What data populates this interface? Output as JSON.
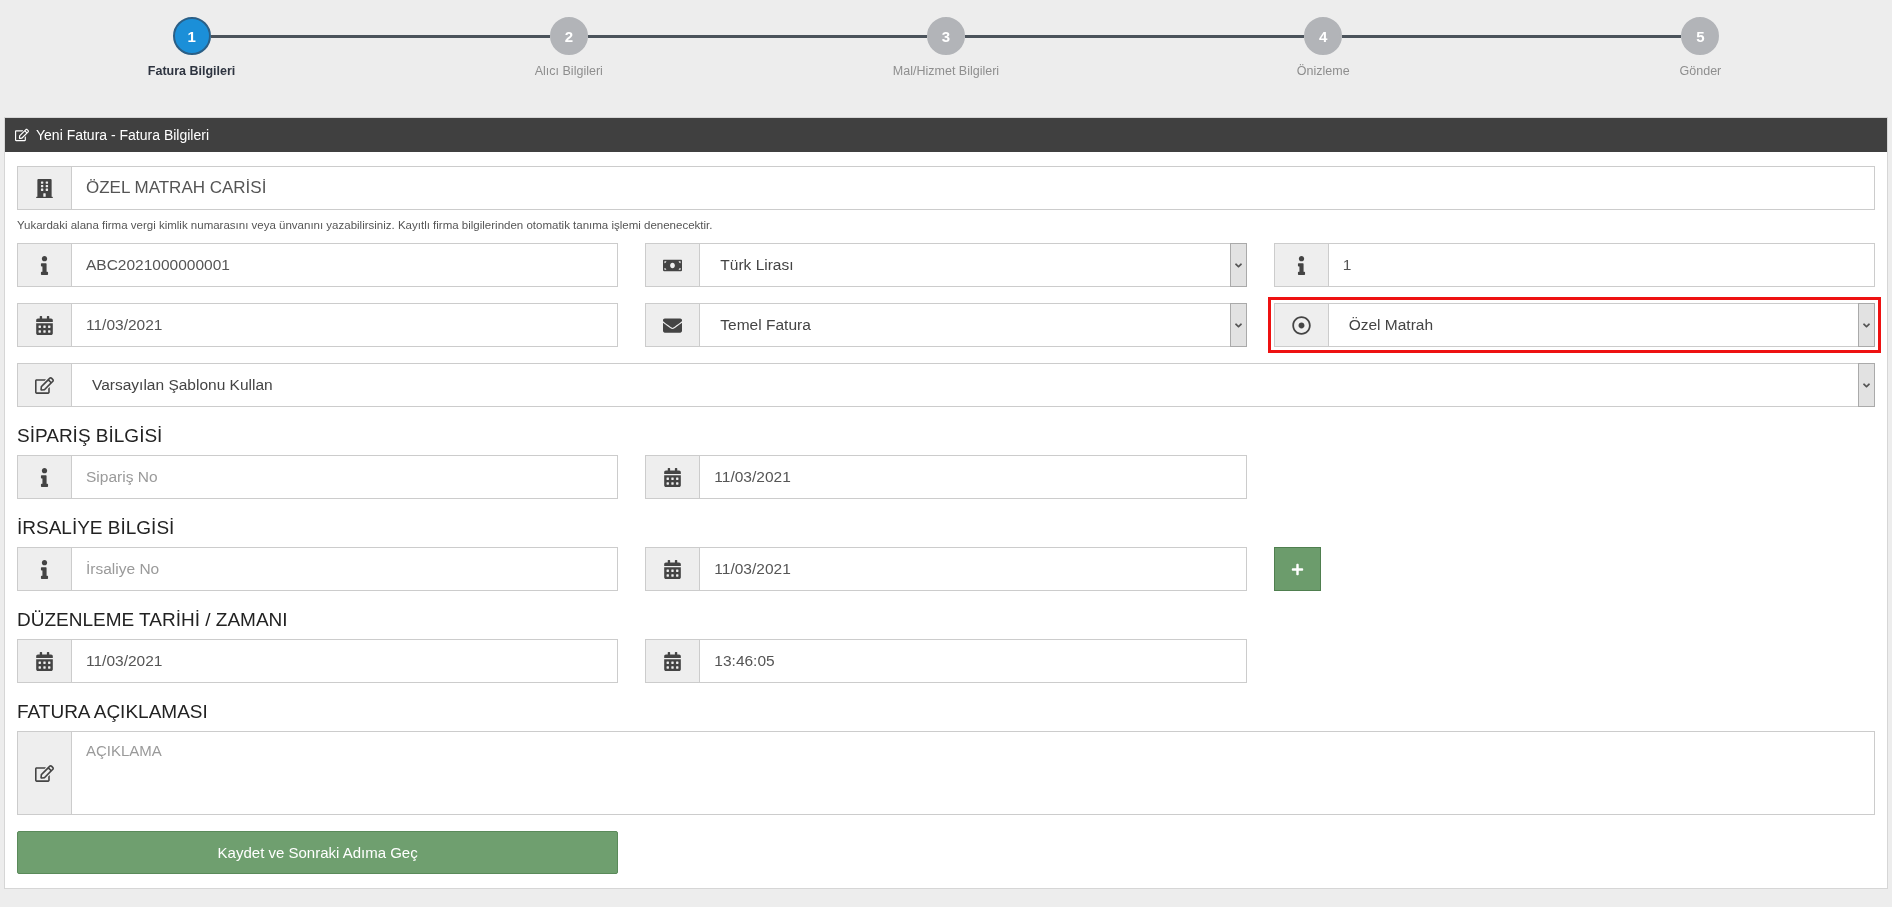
{
  "steps": [
    {
      "number": "1",
      "label": "Fatura Bilgileri",
      "selected": true
    },
    {
      "number": "2",
      "label": "Alıcı Bilgileri",
      "selected": false
    },
    {
      "number": "3",
      "label": "Mal/Hizmet Bilgileri",
      "selected": false
    },
    {
      "number": "4",
      "label": "Önizleme",
      "selected": false
    },
    {
      "number": "5",
      "label": "Gönder",
      "selected": false
    }
  ],
  "panel": {
    "title": "Yeni Fatura - Fatura Bilgileri"
  },
  "company": {
    "kind": "building",
    "value": "ÖZEL MATRAH CARİSİ"
  },
  "hint": "Yukardaki alana firma vergi kimlik numarasını veya ünvanını yazabilirsiniz. Kayıtlı firma bilgilerinden otomatik tanıma işlemi denenecektir.",
  "rows": [
    [
      {
        "kind": "info",
        "value": "ABC2021000000001",
        "dropdown": false
      },
      {
        "kind": "money",
        "value": "Türk Lirası",
        "dropdown": true
      },
      {
        "kind": "info",
        "value": "1",
        "dropdown": false
      }
    ],
    [
      {
        "kind": "date",
        "value": "11/03/2021",
        "dropdown": false
      },
      {
        "kind": "mail",
        "value": "Temel Fatura",
        "dropdown": true
      },
      {
        "kind": "target",
        "value": "Özel Matrah",
        "dropdown": true,
        "highlighted": true
      }
    ],
    [
      {
        "kind": "edit",
        "value": "Varsayılan Şablonu Kullan",
        "dropdown": true
      }
    ]
  ],
  "sections": [
    {
      "heading": "SİPARİŞ BİLGİSİ",
      "fields": [
        {
          "kind": "info",
          "placeholder": "Sipariş No"
        },
        {
          "kind": "date",
          "value": "11/03/2021"
        }
      ]
    },
    {
      "heading": "İRSALİYE BİLGİSİ",
      "fields": [
        {
          "kind": "info",
          "placeholder": "İrsaliye No"
        },
        {
          "kind": "date",
          "value": "11/03/2021"
        },
        {
          "kind": "add"
        }
      ]
    },
    {
      "heading": "DÜZENLEME TARİHİ / ZAMANI",
      "fields": [
        {
          "kind": "date",
          "value": "11/03/2021"
        },
        {
          "kind": "date",
          "value": "13:46:05"
        }
      ]
    }
  ],
  "description": {
    "heading": "FATURA AÇIKLAMASI",
    "kind": "edit",
    "placeholder": "AÇIKLAMA"
  },
  "submit": "Kaydet ve Sonraki Adıma Geç"
}
